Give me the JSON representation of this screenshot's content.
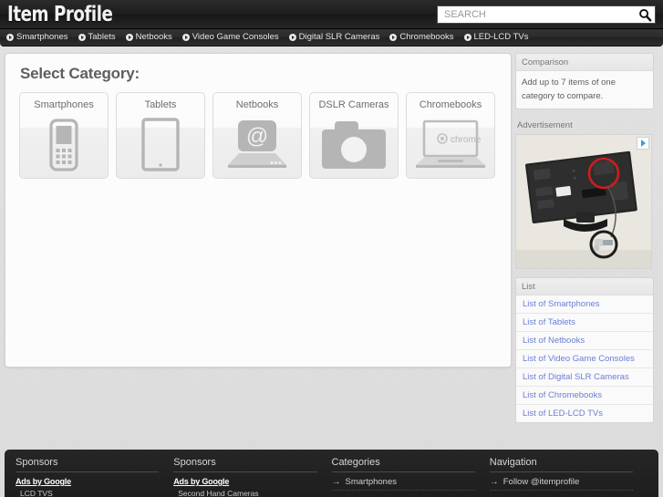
{
  "header": {
    "logo": "Item Profile",
    "search": {
      "placeholder": "SEARCH",
      "value": "",
      "icon": "search-icon"
    }
  },
  "nav": {
    "items": [
      {
        "label": "Smartphones"
      },
      {
        "label": "Tablets"
      },
      {
        "label": "Netbooks"
      },
      {
        "label": "Video Game Consoles"
      },
      {
        "label": "Digital SLR Cameras"
      },
      {
        "label": "Chromebooks"
      },
      {
        "label": "LED-LCD TVs"
      }
    ]
  },
  "main": {
    "title": "Select Category:",
    "cards": [
      {
        "label": "Smartphones",
        "icon": "smartphone-icon"
      },
      {
        "label": "Tablets",
        "icon": "tablet-icon"
      },
      {
        "label": "Netbooks",
        "icon": "netbook-icon"
      },
      {
        "label": "DSLR Cameras",
        "icon": "camera-icon"
      },
      {
        "label": "Chromebooks",
        "icon": "chromebook-icon"
      }
    ]
  },
  "sidebar": {
    "comparison": {
      "title": "Comparison",
      "text": "Add up to 7 items of one category to compare."
    },
    "advertisement": {
      "title": "Advertisement",
      "adchoices_icon": "adchoices-icon",
      "image_alt": "LED TV rear panel with security lock"
    },
    "list": {
      "title": "List",
      "links": [
        {
          "label": "List of Smartphones"
        },
        {
          "label": "List of Tablets"
        },
        {
          "label": "List of Netbooks"
        },
        {
          "label": "List of Video Game Consoles"
        },
        {
          "label": "List of Digital SLR Cameras"
        },
        {
          "label": "List of Chromebooks"
        },
        {
          "label": "List of LED-LCD TVs"
        }
      ]
    }
  },
  "footer": {
    "columns": [
      {
        "title": "Sponsors",
        "ads_label": "Ads by Google",
        "ad_text": "LCD TVS"
      },
      {
        "title": "Sponsors",
        "ads_label": "Ads by Google",
        "ad_text": "Second Hand Cameras"
      },
      {
        "title": "Categories",
        "link": "Smartphones",
        "arrow": "→"
      },
      {
        "title": "Navigation",
        "link": "Follow @itemprofile",
        "arrow": "→"
      }
    ]
  },
  "colors": {
    "header_bg": "#1d1d1d",
    "nav_bg": "#2a2a2a",
    "page_bg": "#dedede",
    "panel_bg": "#fcfcfc",
    "link_blue": "#6b7fd7",
    "icon_gray": "#b0b0b0",
    "adchoices_blue": "#2d9fe0"
  }
}
